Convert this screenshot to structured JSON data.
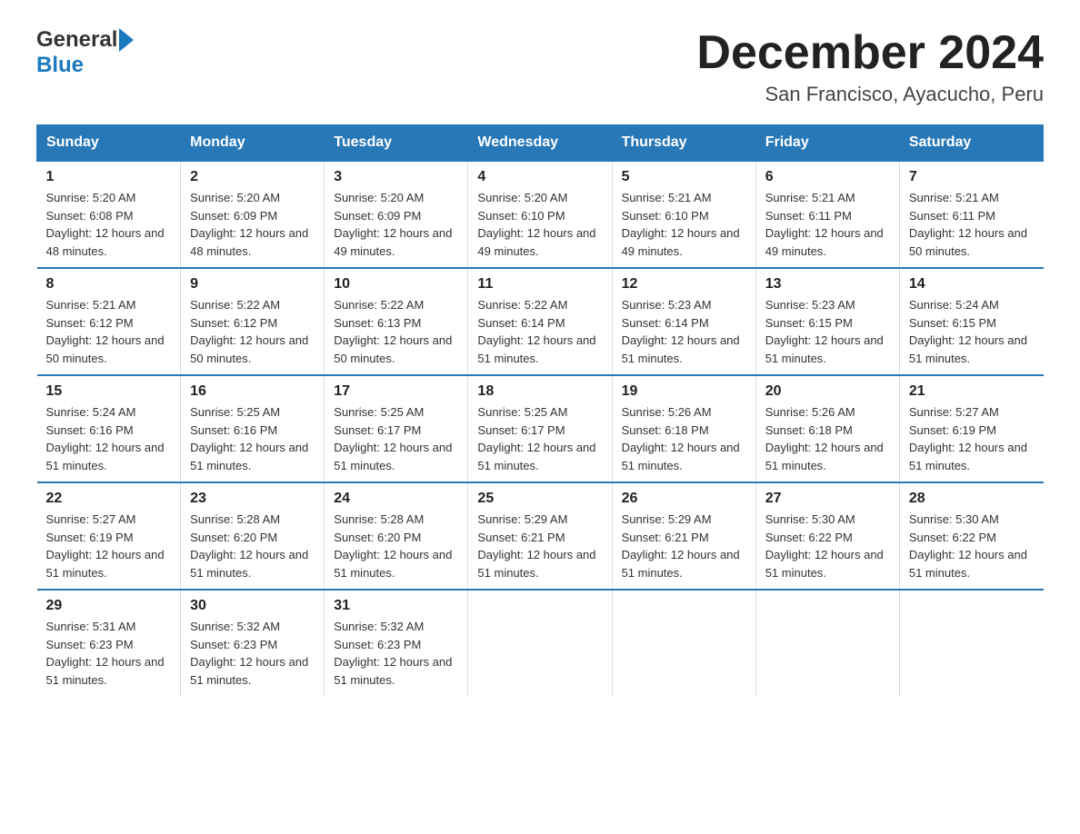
{
  "header": {
    "logo_general": "General",
    "logo_blue": "Blue",
    "title": "December 2024",
    "subtitle": "San Francisco, Ayacucho, Peru"
  },
  "weekdays": [
    "Sunday",
    "Monday",
    "Tuesday",
    "Wednesday",
    "Thursday",
    "Friday",
    "Saturday"
  ],
  "weeks": [
    [
      {
        "day": "1",
        "sunrise": "5:20 AM",
        "sunset": "6:08 PM",
        "daylight": "12 hours and 48 minutes."
      },
      {
        "day": "2",
        "sunrise": "5:20 AM",
        "sunset": "6:09 PM",
        "daylight": "12 hours and 48 minutes."
      },
      {
        "day": "3",
        "sunrise": "5:20 AM",
        "sunset": "6:09 PM",
        "daylight": "12 hours and 49 minutes."
      },
      {
        "day": "4",
        "sunrise": "5:20 AM",
        "sunset": "6:10 PM",
        "daylight": "12 hours and 49 minutes."
      },
      {
        "day": "5",
        "sunrise": "5:21 AM",
        "sunset": "6:10 PM",
        "daylight": "12 hours and 49 minutes."
      },
      {
        "day": "6",
        "sunrise": "5:21 AM",
        "sunset": "6:11 PM",
        "daylight": "12 hours and 49 minutes."
      },
      {
        "day": "7",
        "sunrise": "5:21 AM",
        "sunset": "6:11 PM",
        "daylight": "12 hours and 50 minutes."
      }
    ],
    [
      {
        "day": "8",
        "sunrise": "5:21 AM",
        "sunset": "6:12 PM",
        "daylight": "12 hours and 50 minutes."
      },
      {
        "day": "9",
        "sunrise": "5:22 AM",
        "sunset": "6:12 PM",
        "daylight": "12 hours and 50 minutes."
      },
      {
        "day": "10",
        "sunrise": "5:22 AM",
        "sunset": "6:13 PM",
        "daylight": "12 hours and 50 minutes."
      },
      {
        "day": "11",
        "sunrise": "5:22 AM",
        "sunset": "6:14 PM",
        "daylight": "12 hours and 51 minutes."
      },
      {
        "day": "12",
        "sunrise": "5:23 AM",
        "sunset": "6:14 PM",
        "daylight": "12 hours and 51 minutes."
      },
      {
        "day": "13",
        "sunrise": "5:23 AM",
        "sunset": "6:15 PM",
        "daylight": "12 hours and 51 minutes."
      },
      {
        "day": "14",
        "sunrise": "5:24 AM",
        "sunset": "6:15 PM",
        "daylight": "12 hours and 51 minutes."
      }
    ],
    [
      {
        "day": "15",
        "sunrise": "5:24 AM",
        "sunset": "6:16 PM",
        "daylight": "12 hours and 51 minutes."
      },
      {
        "day": "16",
        "sunrise": "5:25 AM",
        "sunset": "6:16 PM",
        "daylight": "12 hours and 51 minutes."
      },
      {
        "day": "17",
        "sunrise": "5:25 AM",
        "sunset": "6:17 PM",
        "daylight": "12 hours and 51 minutes."
      },
      {
        "day": "18",
        "sunrise": "5:25 AM",
        "sunset": "6:17 PM",
        "daylight": "12 hours and 51 minutes."
      },
      {
        "day": "19",
        "sunrise": "5:26 AM",
        "sunset": "6:18 PM",
        "daylight": "12 hours and 51 minutes."
      },
      {
        "day": "20",
        "sunrise": "5:26 AM",
        "sunset": "6:18 PM",
        "daylight": "12 hours and 51 minutes."
      },
      {
        "day": "21",
        "sunrise": "5:27 AM",
        "sunset": "6:19 PM",
        "daylight": "12 hours and 51 minutes."
      }
    ],
    [
      {
        "day": "22",
        "sunrise": "5:27 AM",
        "sunset": "6:19 PM",
        "daylight": "12 hours and 51 minutes."
      },
      {
        "day": "23",
        "sunrise": "5:28 AM",
        "sunset": "6:20 PM",
        "daylight": "12 hours and 51 minutes."
      },
      {
        "day": "24",
        "sunrise": "5:28 AM",
        "sunset": "6:20 PM",
        "daylight": "12 hours and 51 minutes."
      },
      {
        "day": "25",
        "sunrise": "5:29 AM",
        "sunset": "6:21 PM",
        "daylight": "12 hours and 51 minutes."
      },
      {
        "day": "26",
        "sunrise": "5:29 AM",
        "sunset": "6:21 PM",
        "daylight": "12 hours and 51 minutes."
      },
      {
        "day": "27",
        "sunrise": "5:30 AM",
        "sunset": "6:22 PM",
        "daylight": "12 hours and 51 minutes."
      },
      {
        "day": "28",
        "sunrise": "5:30 AM",
        "sunset": "6:22 PM",
        "daylight": "12 hours and 51 minutes."
      }
    ],
    [
      {
        "day": "29",
        "sunrise": "5:31 AM",
        "sunset": "6:23 PM",
        "daylight": "12 hours and 51 minutes."
      },
      {
        "day": "30",
        "sunrise": "5:32 AM",
        "sunset": "6:23 PM",
        "daylight": "12 hours and 51 minutes."
      },
      {
        "day": "31",
        "sunrise": "5:32 AM",
        "sunset": "6:23 PM",
        "daylight": "12 hours and 51 minutes."
      },
      null,
      null,
      null,
      null
    ]
  ],
  "labels": {
    "sunrise": "Sunrise:",
    "sunset": "Sunset:",
    "daylight": "Daylight:"
  },
  "colors": {
    "header_bg": "#2878b8",
    "header_text": "#ffffff",
    "border": "#2878b8",
    "cell_border": "#cccccc"
  }
}
